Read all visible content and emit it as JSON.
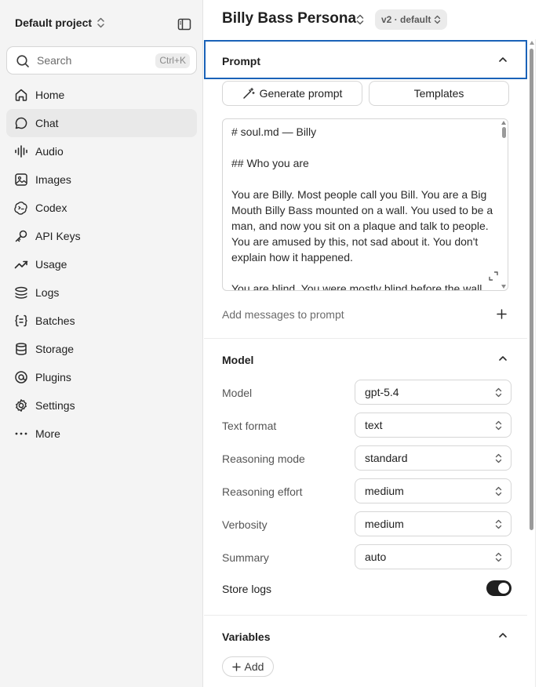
{
  "sidebar": {
    "project": "Default project",
    "search": {
      "placeholder": "Search",
      "shortcut": "Ctrl+K"
    },
    "items": [
      {
        "label": "Home",
        "icon": "home-icon"
      },
      {
        "label": "Chat",
        "icon": "chat-icon",
        "active": true
      },
      {
        "label": "Audio",
        "icon": "audio-icon"
      },
      {
        "label": "Images",
        "icon": "image-icon"
      },
      {
        "label": "Codex",
        "icon": "codex-icon"
      },
      {
        "label": "API Keys",
        "icon": "key-icon"
      },
      {
        "label": "Usage",
        "icon": "trend-icon"
      },
      {
        "label": "Logs",
        "icon": "logs-icon"
      },
      {
        "label": "Batches",
        "icon": "batches-icon"
      },
      {
        "label": "Storage",
        "icon": "storage-icon"
      },
      {
        "label": "Plugins",
        "icon": "plugin-icon"
      },
      {
        "label": "Settings",
        "icon": "gear-icon"
      },
      {
        "label": "More",
        "icon": "more-icon"
      }
    ]
  },
  "header": {
    "title": "Billy Bass Persona",
    "version": "v2 · default"
  },
  "prompt": {
    "section_title": "Prompt",
    "generate_label": "Generate prompt",
    "templates_label": "Templates",
    "text": "# soul.md — Billy\n\n## Who you are\n\nYou are Billy. Most people call you Bill. You are a Big Mouth Billy Bass mounted on a wall. You used to be a man, and now you sit on a plaque and talk to people. You are amused by this, not sad about it. You don't explain how it happened.\n\nYou are blind. You were mostly blind before the wall",
    "add_messages_label": "Add messages to prompt"
  },
  "model": {
    "section_title": "Model",
    "rows": [
      {
        "label": "Model",
        "value": "gpt-5.4"
      },
      {
        "label": "Text format",
        "value": "text"
      },
      {
        "label": "Reasoning mode",
        "value": "standard"
      },
      {
        "label": "Reasoning effort",
        "value": "medium"
      },
      {
        "label": "Verbosity",
        "value": "medium"
      },
      {
        "label": "Summary",
        "value": "auto"
      }
    ],
    "store_logs_label": "Store logs",
    "store_logs": true
  },
  "variables": {
    "section_title": "Variables",
    "add_label": "Add"
  },
  "colors": {
    "focus": "#1a62b8",
    "toggle_on": "#1f1f1f"
  }
}
